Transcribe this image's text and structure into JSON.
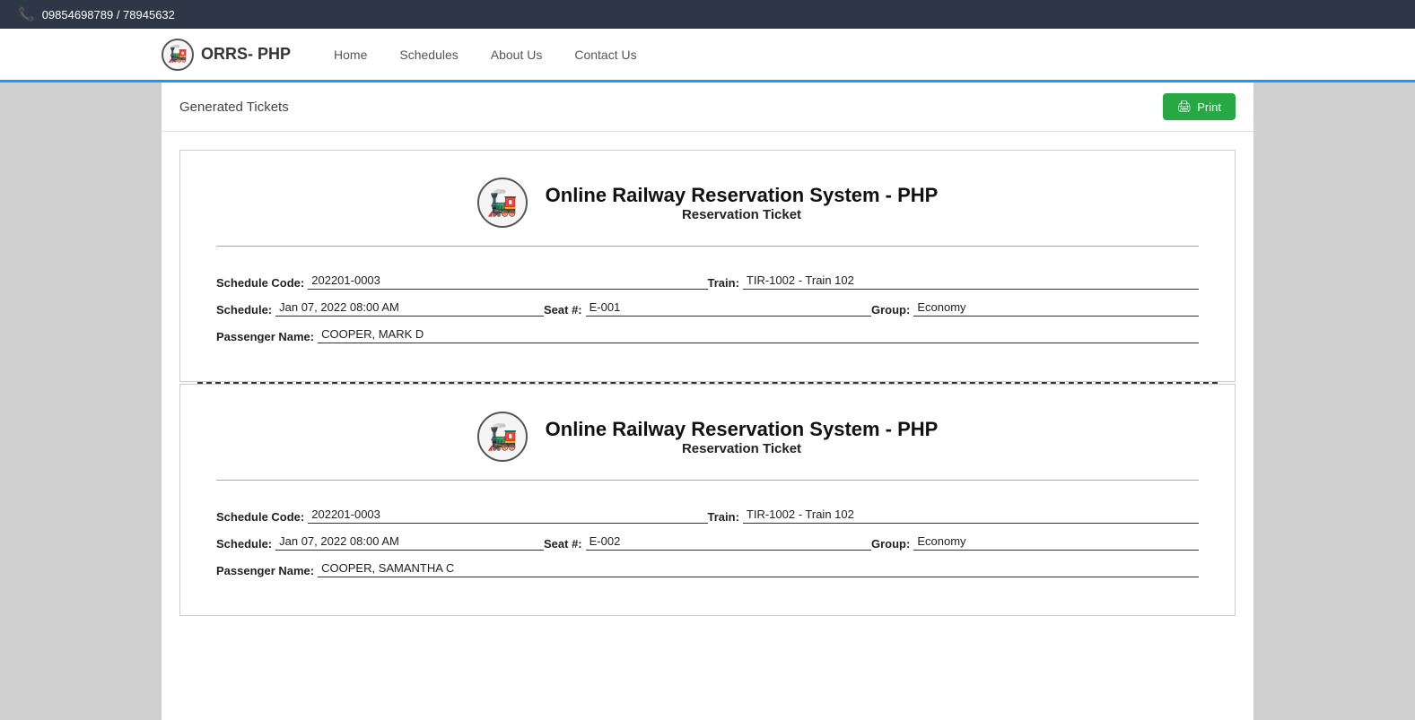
{
  "topbar": {
    "phone": "09854698789 / 78945632"
  },
  "navbar": {
    "brand": "ORRS- PHP",
    "logo_symbol": "🚂",
    "links": [
      {
        "label": "Home",
        "href": "#"
      },
      {
        "label": "Schedules",
        "href": "#"
      },
      {
        "label": "About Us",
        "href": "#"
      },
      {
        "label": "Contact Us",
        "href": "#"
      }
    ]
  },
  "page": {
    "title": "Generated Tickets",
    "print_label": "Print"
  },
  "tickets": [
    {
      "system_name": "Online Railway Reservation System - PHP",
      "ticket_type": "Reservation Ticket",
      "schedule_code_label": "Schedule Code:",
      "schedule_code": "202201-0003",
      "train_label": "Train:",
      "train": "TIR-1002 - Train 102",
      "schedule_label": "Schedule:",
      "schedule": "Jan 07, 2022 08:00 AM",
      "seat_label": "Seat #:",
      "seat": "E-001",
      "group_label": "Group:",
      "group": "Economy",
      "passenger_name_label": "Passenger Name:",
      "passenger_name": "COOPER, MARK D"
    },
    {
      "system_name": "Online Railway Reservation System - PHP",
      "ticket_type": "Reservation Ticket",
      "schedule_code_label": "Schedule Code:",
      "schedule_code": "202201-0003",
      "train_label": "Train:",
      "train": "TIR-1002 - Train 102",
      "schedule_label": "Schedule:",
      "schedule": "Jan 07, 2022 08:00 AM",
      "seat_label": "Seat #:",
      "seat": "E-002",
      "group_label": "Group:",
      "group": "Economy",
      "passenger_name_label": "Passenger Name:",
      "passenger_name": "COOPER, SAMANTHA C"
    }
  ]
}
